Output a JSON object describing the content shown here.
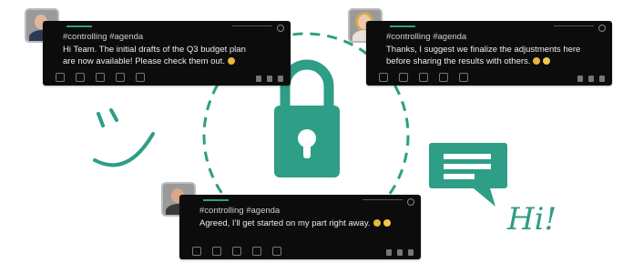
{
  "colors": {
    "brand": "#2e9e86",
    "card_bg": "#0c0c0c",
    "text_light": "#ededed"
  },
  "posts": [
    {
      "id": "post-1",
      "tags": "#controlling #agenda",
      "lines": [
        "Hi Team. The initial drafts of the Q3 budget plan",
        "are now available! Please check them out."
      ],
      "avatar": "man-suit"
    },
    {
      "id": "post-2",
      "tags": "#controlling #agenda",
      "lines": [
        "Thanks, I suggest we finalize the adjustments here",
        "before sharing the results with others."
      ],
      "avatar": "woman-blonde"
    },
    {
      "id": "post-3",
      "tags": "#controlling #agenda",
      "lines": [
        "Agreed, I'll get started on my part right away."
      ],
      "avatar": "man-beard"
    }
  ],
  "decor": {
    "lock_icon": "padlock-icon",
    "chat_icon": "message-bubble-icon",
    "smile_icon": "smile-doodle-icon",
    "greeting": "Hi!"
  }
}
